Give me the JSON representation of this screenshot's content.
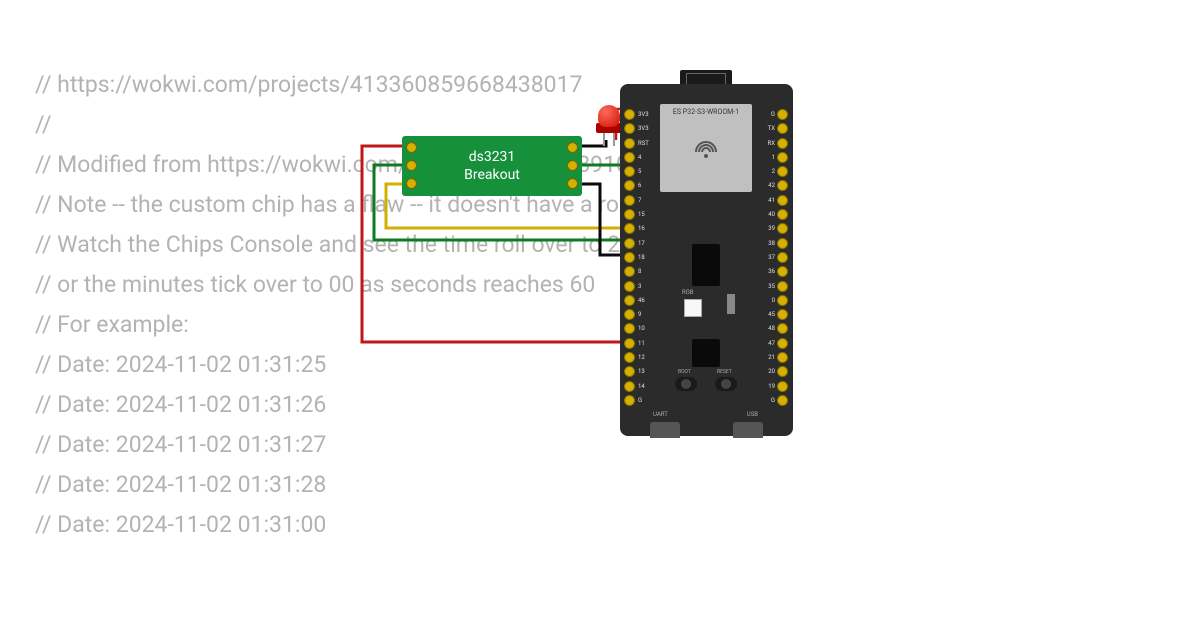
{
  "code": {
    "lines": [
      "// https://wokwi.com/projects/413360859668438017",
      "//",
      "// Modified from https://wokwi.com/projects/405471891021837313",
      "// Note -- the custom chip has a flaw -- it doesn't have a rollover counting.",
      "// Watch the Chips Console and see the time roll over to 2020",
      "// or the minutes tick over to 00 as seconds reaches 60",
      "// For example:",
      "// Date: 2024-11-02 01:31:25",
      "// Date: 2024-11-02 01:31:26",
      "// Date: 2024-11-02 01:31:27",
      "// Date: 2024-11-02 01:31:28",
      "// Date: 2024-11-02 01:31:00"
    ]
  },
  "components": {
    "module": {
      "line1": "ds3231",
      "line2": "Breakout"
    },
    "board": {
      "shield_label": "ES P32-S3-WROOM-1",
      "rgb_label": "RGB",
      "boot_label": "BOOT",
      "reset_label": "RESET",
      "uart_label": "UART",
      "usb_label": "USB",
      "pins_left": [
        "3V3",
        "3V3",
        "RST",
        "4",
        "5",
        "6",
        "7",
        "15",
        "16",
        "17",
        "18",
        "8",
        "3",
        "46",
        "9",
        "10",
        "11",
        "12",
        "13",
        "14",
        "G"
      ],
      "pins_right": [
        "G",
        "TX",
        "RX",
        "1",
        "2",
        "42",
        "41",
        "40",
        "39",
        "38",
        "37",
        "36",
        "35",
        "0",
        "45",
        "48",
        "47",
        "21",
        "20",
        "19",
        "G"
      ]
    },
    "wires": {
      "colors": {
        "power": "#c01818",
        "ground": "#0a0a0a",
        "sda": "#0f7a1f",
        "scl": "#d0b000"
      }
    }
  }
}
